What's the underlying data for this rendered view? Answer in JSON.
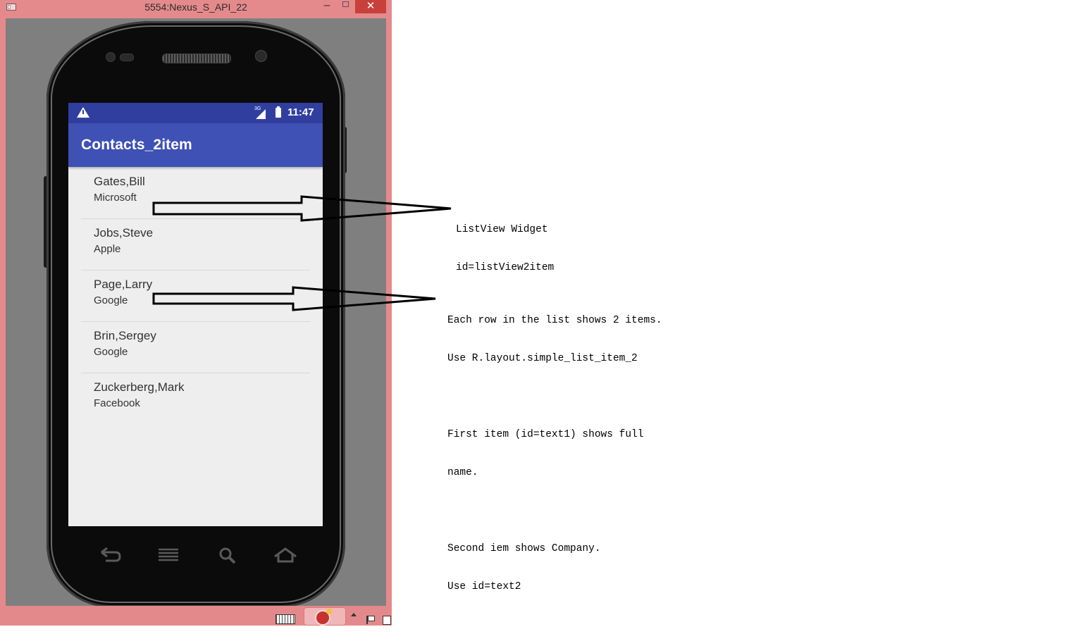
{
  "window": {
    "title": "5554:Nexus_S_API_22",
    "minimize": "–",
    "close": "✕"
  },
  "status_bar": {
    "network": "3G",
    "time": "11:47"
  },
  "app": {
    "title": "Contacts_2item"
  },
  "contacts": [
    {
      "name": "Gates,Bill",
      "company": "Microsoft"
    },
    {
      "name": "Jobs,Steve",
      "company": "Apple"
    },
    {
      "name": "Page,Larry",
      "company": "Google"
    },
    {
      "name": "Brin,Sergey",
      "company": "Google"
    },
    {
      "name": "Zuckerberg,Mark",
      "company": "Facebook"
    }
  ],
  "nav_buttons": [
    "back-icon",
    "menu-icon",
    "search-icon",
    "home-icon"
  ],
  "annotations": {
    "listview": {
      "line1": "ListView Widget",
      "line2": "id=listView2item"
    },
    "rows": {
      "line1": "Each row in the list shows 2 items.",
      "line2": "Use R.layout.simple_list_item_2",
      "line3": "",
      "line4": "First item (id=text1) shows full",
      "line5": "name.",
      "line6": "",
      "line7": "Second iem shows Company.",
      "line8": "Use id=text2"
    }
  },
  "colors": {
    "status_bar": "#303f9f",
    "app_bar": "#3f51b5",
    "window_frame": "#e58a8c",
    "close_button": "#c7413a"
  }
}
